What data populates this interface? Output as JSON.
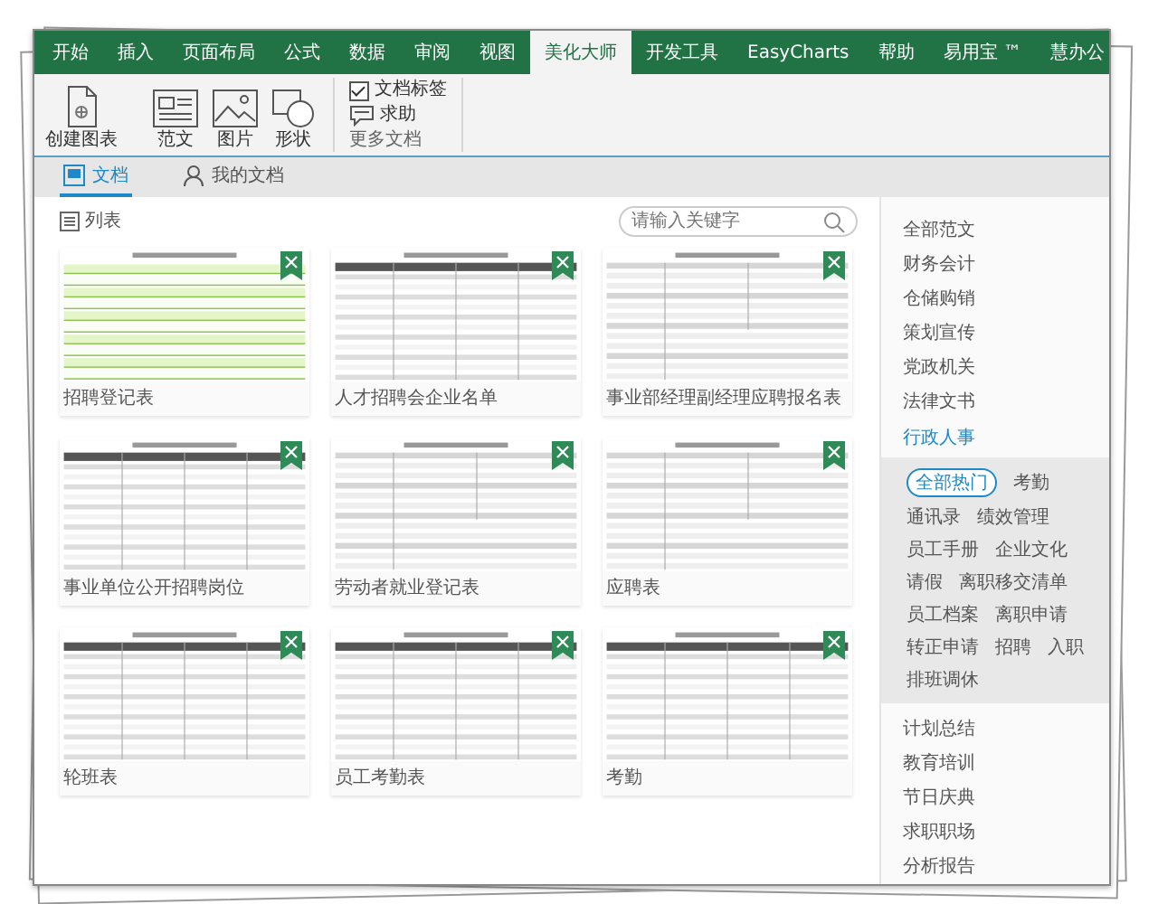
{
  "ribbon_tabs": [
    {
      "label": "开始",
      "selected": false
    },
    {
      "label": "插入",
      "selected": false
    },
    {
      "label": "页面布局",
      "selected": false
    },
    {
      "label": "公式",
      "selected": false
    },
    {
      "label": "数据",
      "selected": false
    },
    {
      "label": "审阅",
      "selected": false
    },
    {
      "label": "视图",
      "selected": false
    },
    {
      "label": "美化大师",
      "selected": true
    },
    {
      "label": "开发工具",
      "selected": false
    },
    {
      "label": "EasyCharts",
      "selected": false
    },
    {
      "label": "帮助",
      "selected": false
    },
    {
      "label": "易用宝 ™",
      "selected": false
    },
    {
      "label": "慧办公",
      "selected": false
    }
  ],
  "ribbon_buttons": [
    {
      "label": "创建图表",
      "kind": "chart"
    },
    {
      "label": "范文",
      "kind": "document"
    },
    {
      "label": "图片",
      "kind": "picture"
    },
    {
      "label": "形状",
      "kind": "shape"
    }
  ],
  "ribbon_options": [
    {
      "label": "文档标签",
      "kind": "checkbox",
      "checked": true
    },
    {
      "label": "求助",
      "kind": "help"
    }
  ],
  "ribbon_group_label": "更多文档",
  "doc_tabs": [
    {
      "label": "文档",
      "kind": "docs",
      "selected": true
    },
    {
      "label": "我的文档",
      "kind": "user",
      "selected": false
    }
  ],
  "list_toggle": "列表",
  "search": {
    "placeholder": "请输入关键字"
  },
  "templates": [
    {
      "name": "招聘登记表",
      "kind": "green"
    },
    {
      "name": "人才招聘会企业名单",
      "kind": "table"
    },
    {
      "name": "事业部经理副经理应聘报名表",
      "kind": "form"
    },
    {
      "name": "事业单位公开招聘岗位",
      "kind": "table"
    },
    {
      "name": "劳动者就业登记表",
      "kind": "form"
    },
    {
      "name": "应聘表",
      "kind": "form"
    },
    {
      "name": "轮班表",
      "kind": "table"
    },
    {
      "name": "员工考勤表",
      "kind": "table"
    },
    {
      "name": "考勤",
      "kind": "table"
    }
  ],
  "categories": [
    {
      "label": "全部范文",
      "selected": false
    },
    {
      "label": "财务会计",
      "selected": false
    },
    {
      "label": "仓储购销",
      "selected": false
    },
    {
      "label": "策划宣传",
      "selected": false
    },
    {
      "label": "党政机关",
      "selected": false
    },
    {
      "label": "法律文书",
      "selected": false
    },
    {
      "label": "行政人事",
      "selected": true,
      "tags": [
        {
          "label": "全部热门",
          "selected": true
        },
        {
          "label": "考勤",
          "selected": false
        },
        {
          "label": "通讯录",
          "selected": false
        },
        {
          "label": "绩效管理",
          "selected": false
        },
        {
          "label": "员工手册",
          "selected": false
        },
        {
          "label": "企业文化",
          "selected": false
        },
        {
          "label": "请假",
          "selected": false
        },
        {
          "label": "离职移交清单",
          "selected": false
        },
        {
          "label": "员工档案",
          "selected": false
        },
        {
          "label": "离职申请",
          "selected": false
        },
        {
          "label": "转正申请",
          "selected": false
        },
        {
          "label": "招聘",
          "selected": false
        },
        {
          "label": "入职",
          "selected": false
        },
        {
          "label": "排班调休",
          "selected": false
        }
      ]
    },
    {
      "label": "计划总结",
      "selected": false
    },
    {
      "label": "教育培训",
      "selected": false
    },
    {
      "label": "节日庆典",
      "selected": false
    },
    {
      "label": "求职职场",
      "selected": false
    },
    {
      "label": "分析报告",
      "selected": false
    }
  ]
}
